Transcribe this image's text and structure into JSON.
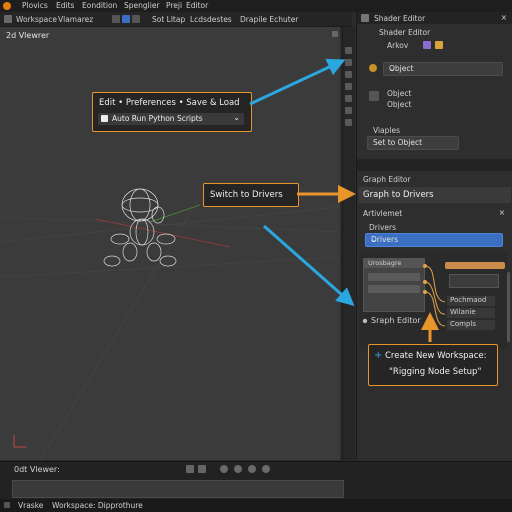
{
  "menubar": {
    "items": [
      "Plovics",
      "Edits",
      "Eondition",
      "Spenglier",
      "Preji",
      "Editor"
    ]
  },
  "tabbar": {
    "items": [
      "Workspace",
      "Vlamarez",
      "Sot Lltap",
      "Lcdsdestes",
      "Drapile Echuter"
    ]
  },
  "viewport": {
    "title": "2d Vlewrer"
  },
  "right_panel": {
    "shader_editor_header": "Shader Editor",
    "shader_editor_sub": "Shader Editor",
    "arkov_label": "Arkov",
    "object_dropdown": "Object",
    "object_line1": "Object",
    "object_line2": "Object",
    "viaples_label": "Viaples",
    "set_to_object": "Set to Object",
    "graph_editor_label": "Graph Editor",
    "graph_to_drivers": "Graph to Drivers",
    "artivlemet_label": "Artivlemet",
    "drivers_label": "Drivers",
    "drivers_dropdown": "Drivers",
    "node_header": "Urosbagre",
    "graph_editor_node": "Sraph Editor",
    "node_out1": "Pochmaod",
    "node_out2": "Wilanie",
    "node_out3": "Compls"
  },
  "callouts": {
    "edit_prefs": "Edit • Preferences • Save & Load",
    "auto_run": "Auto Run Python Scripts",
    "switch_drivers": "Switch to Drivers",
    "create_ws_line1": "Create New Workspace:",
    "create_ws_line2": "\"Rigging Node Setup\""
  },
  "timeline": {
    "label": "0dt Vlewer:"
  },
  "statusbar": {
    "left": "Vraske",
    "workspace": "Workspace: Dipprothure"
  },
  "colors": {
    "accent_orange": "#e8952c",
    "arrow_blue": "#2aa7e0",
    "select_blue": "#3a6fc4"
  }
}
